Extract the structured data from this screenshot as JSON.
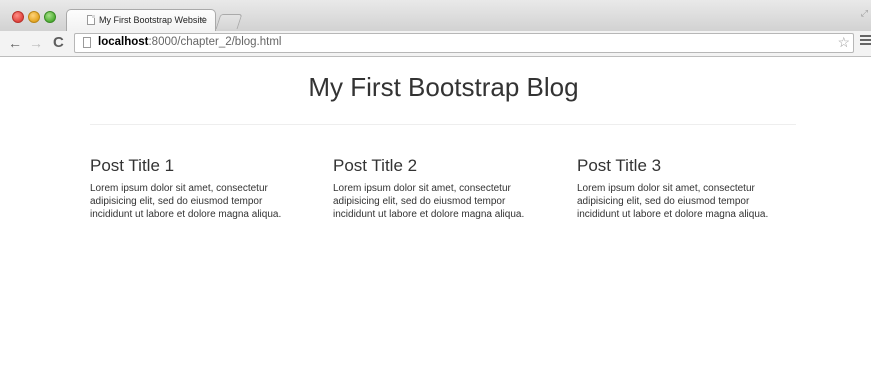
{
  "browser": {
    "tab": {
      "title": "My First Bootstrap Website",
      "close_glyph": "×"
    },
    "toolbar": {
      "back_glyph": "←",
      "forward_glyph": "→",
      "reload_glyph": "C",
      "url_host": "localhost",
      "url_rest": ":8000/chapter_2/blog.html",
      "star_glyph": "☆"
    },
    "icons": [
      "close-icon",
      "minimize-icon",
      "maximize-icon",
      "page-icon",
      "back-arrow-icon",
      "forward-arrow-icon",
      "reload-icon",
      "star-icon",
      "menu-icon"
    ]
  },
  "page": {
    "title": "My First Bootstrap Blog",
    "posts": [
      {
        "title": "Post Title 1",
        "body": "Lorem ipsum dolor sit amet, consectetur adipisicing elit, sed do eiusmod tempor incididunt ut labore et dolore magna aliqua."
      },
      {
        "title": "Post Title 2",
        "body": "Lorem ipsum dolor sit amet, consectetur adipisicing elit, sed do eiusmod tempor incididunt ut labore et dolore magna aliqua."
      },
      {
        "title": "Post Title 3",
        "body": "Lorem ipsum dolor sit amet, consectetur adipisicing elit, sed do eiusmod tempor incididunt ut labore et dolore magna aliqua."
      }
    ]
  }
}
